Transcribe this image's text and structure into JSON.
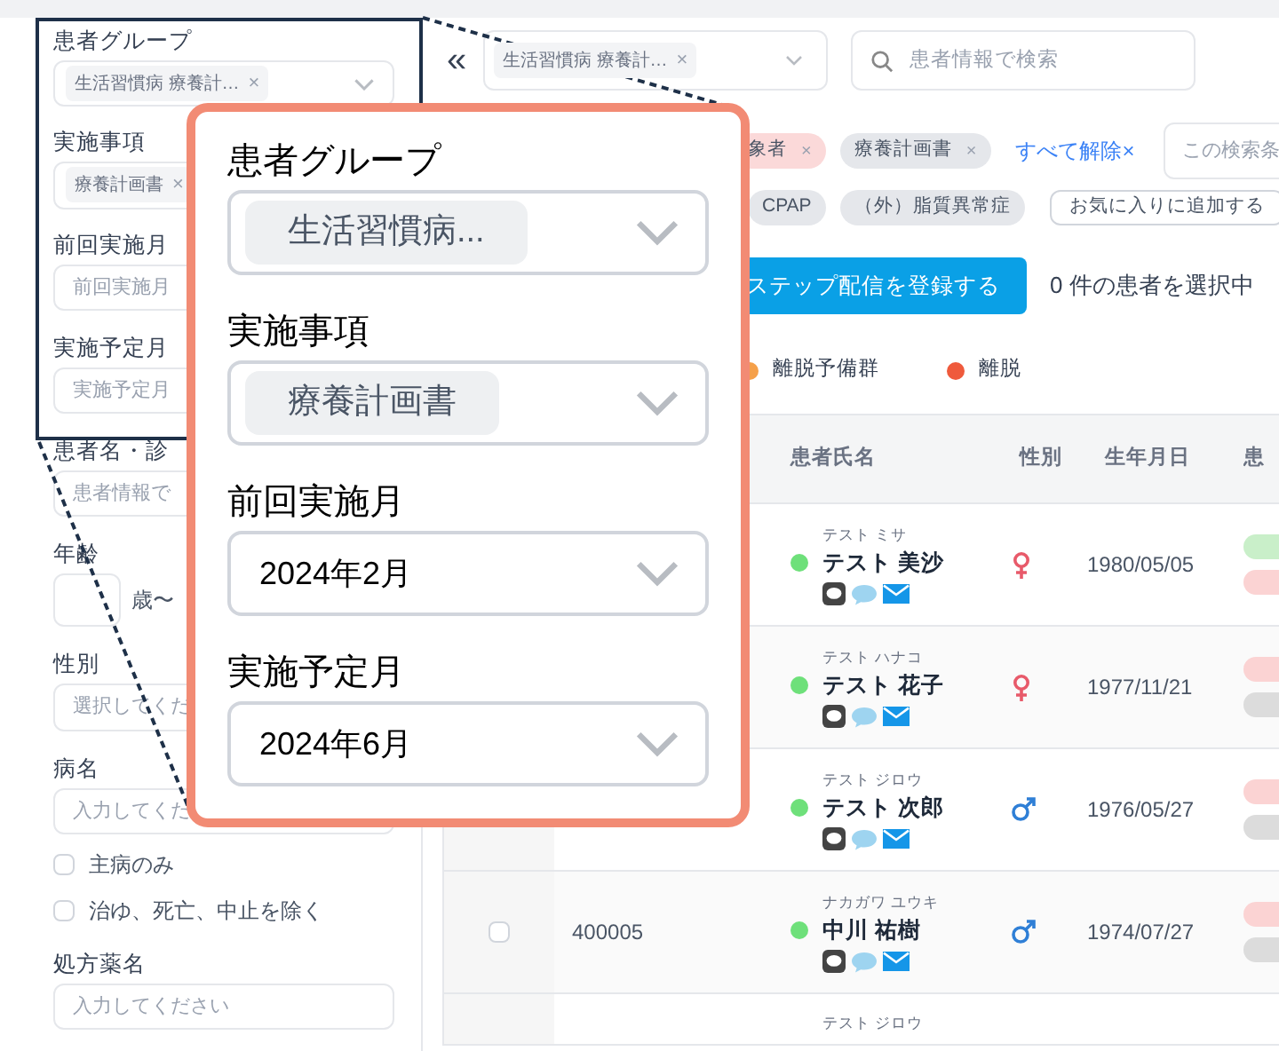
{
  "sidebar": {
    "fields": [
      {
        "label": "患者グループ",
        "kind": "tags",
        "tags": [
          {
            "text": "生活習慣病 療養計…",
            "close": "×"
          }
        ]
      },
      {
        "label": "実施事項",
        "kind": "tags",
        "tags": [
          {
            "text": "療養計画書",
            "close": "×"
          }
        ]
      },
      {
        "label": "前回実施月",
        "kind": "text",
        "placeholder": "前回実施月"
      },
      {
        "label": "実施予定月",
        "kind": "text",
        "placeholder": "実施予定月"
      },
      {
        "label": "患者名・診",
        "kind": "text",
        "placeholder": "患者情報で"
      },
      {
        "label": "年齢",
        "kind": "age",
        "unit": "歳〜"
      },
      {
        "label": "性別",
        "kind": "text",
        "placeholder": "選択してくだ"
      },
      {
        "label": "病名",
        "kind": "text",
        "placeholder": "入力してくだ"
      },
      {
        "label": "主病のみ",
        "kind": "checkbox",
        "checked": false
      },
      {
        "label": "治ゆ、死亡、中止を除く",
        "kind": "checkbox",
        "checked": false
      },
      {
        "label": "処方薬名",
        "kind": "text",
        "placeholder": "入力してください"
      }
    ]
  },
  "toolbar": {
    "collapse": "«",
    "group_select": {
      "tags": [
        {
          "text": "生活習慣病 療養計…",
          "close": "×"
        }
      ]
    },
    "search": {
      "placeholder": "患者情報で検索"
    }
  },
  "active_filters": [
    {
      "text": "象者",
      "close": "×",
      "color": "#fbd9d9"
    },
    {
      "text": "療養計画書",
      "close": "×",
      "color": "#e5e7eb"
    }
  ],
  "clear_all": "すべて解除×",
  "save_field": {
    "placeholder": "この検索条"
  },
  "filters_row_2": [
    {
      "text": "CPAP",
      "color": "#e5e7eb"
    },
    {
      "text": "（外）脂質異常症",
      "color": "#e5e7eb"
    }
  ],
  "favorite_button": "お気に入りに追加する",
  "register_button": "ステップ配信を登録する",
  "selection_count": "0 件の患者を選択中",
  "legend": [
    {
      "label": "離脱予備群",
      "color": "#f5a04a"
    },
    {
      "label": "離脱",
      "color": "#ef5a3c"
    }
  ],
  "table": {
    "columns": [
      "患者氏名",
      "性別",
      "生年月日",
      "患"
    ],
    "rows": [
      {
        "kana": "テスト ミサ",
        "name": "テスト 美沙",
        "color": "#6ee07a",
        "kind": "female",
        "birth": "1980/05/05",
        "badges": [
          {
            "color": "#c9efc9"
          },
          {
            "color": "#fbd3d3"
          }
        ]
      },
      {
        "kana": "テスト ハナコ",
        "name": "テスト 花子",
        "color": "#6ee07a",
        "kind": "female",
        "birth": "1977/11/21",
        "badges": [
          {
            "color": "#fbd3d3"
          },
          {
            "color": "#dcdcdc"
          }
        ]
      },
      {
        "kana": "テスト ジロウ",
        "name": "テスト 次郎",
        "color": "#6ee07a",
        "kind": "male",
        "birth": "1976/05/27",
        "badges": [
          {
            "color": "#fbd3d3"
          },
          {
            "color": "#dcdcdc"
          }
        ]
      },
      {
        "checked": false,
        "id": "400005",
        "kana": "ナカガワ ユウキ",
        "name": "中川 祐樹",
        "color": "#6ee07a",
        "kind": "male",
        "birth": "1974/07/27",
        "badges": [
          {
            "color": "#fbd3d3"
          },
          {
            "color": "#dcdcdc"
          }
        ]
      },
      {
        "kana": "テスト ジロウ"
      }
    ]
  },
  "callout": {
    "fields": [
      {
        "label": "患者グループ",
        "kind": "tags",
        "tags": [
          {
            "text": "生活習慣病..."
          }
        ]
      },
      {
        "label": "実施事項",
        "kind": "tags",
        "tags": [
          {
            "text": "療養計画書"
          }
        ]
      },
      {
        "label": "前回実施月",
        "kind": "value",
        "value": "2024年2月"
      },
      {
        "label": "実施予定月",
        "kind": "value",
        "value": "2024年6月"
      }
    ]
  }
}
